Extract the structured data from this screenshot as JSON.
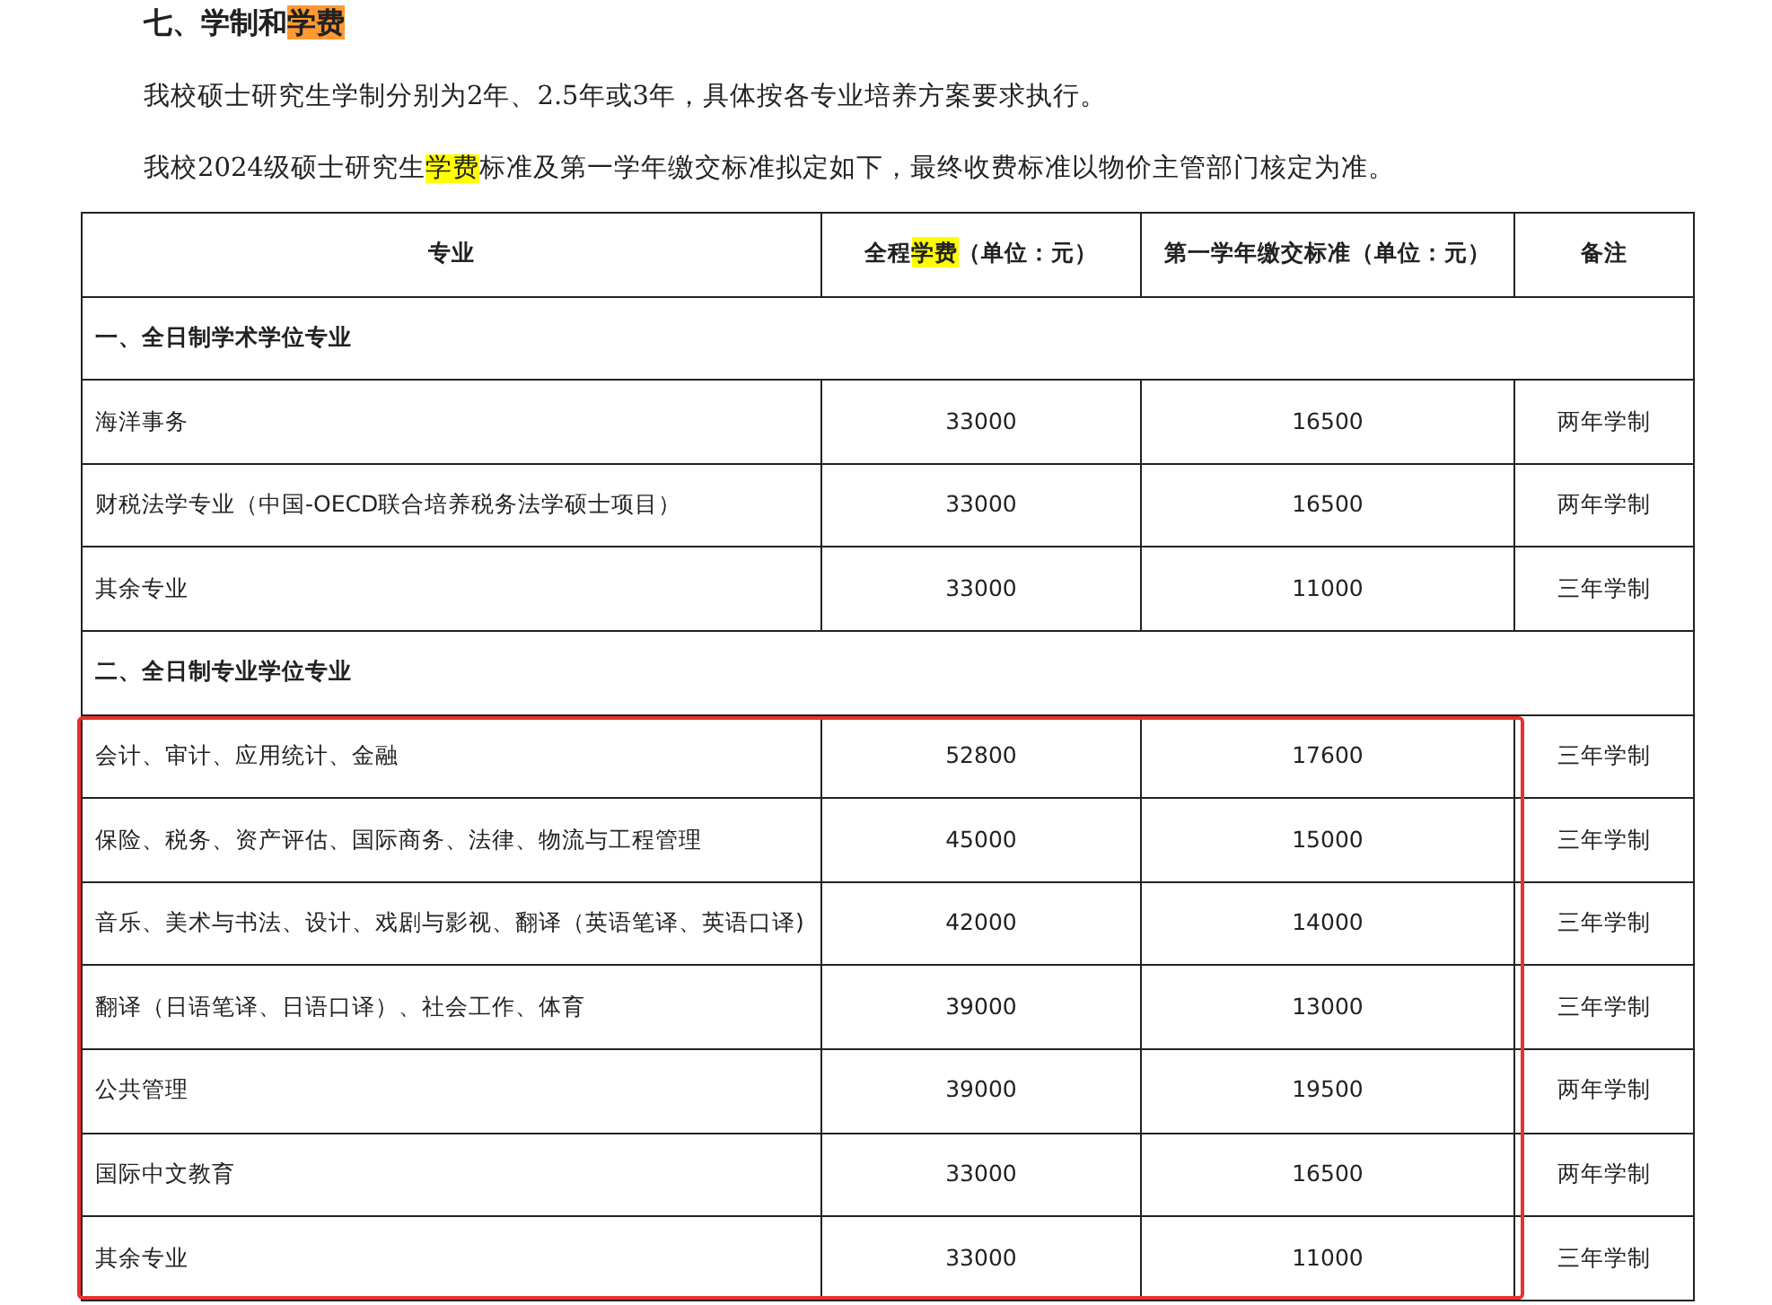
{
  "heading": {
    "segments": [
      {
        "text": "七、学制和"
      },
      {
        "text": "学费",
        "color": "#ff9933"
      }
    ]
  },
  "paragraphs": [
    {
      "segments": [
        {
          "text": "我校硕士研究生学制分别为2年、2.5年或3年，具体按各专业培养方案要求执行。"
        }
      ]
    },
    {
      "segments": [
        {
          "text": "我校2024级硕士研究生"
        },
        {
          "text": "学费",
          "color": "#ffff00"
        },
        {
          "text": "标准及第一学年缴交标准拟定如下，最终收费标准以物价主管部门核定为准。"
        }
      ]
    }
  ],
  "table": {
    "columns": [
      {
        "segments": [
          {
            "text": "专业"
          }
        ]
      },
      {
        "segments": [
          {
            "text": "全程"
          },
          {
            "text": "学费",
            "color": "#ffff00"
          },
          {
            "text": "（单位：元）"
          }
        ]
      },
      {
        "segments": [
          {
            "text": "第一学年缴交标准（单位：元）"
          }
        ]
      },
      {
        "segments": [
          {
            "text": "备注"
          }
        ]
      }
    ],
    "rows": [
      {
        "kind": "section",
        "label": "一、全日制学术学位专业"
      },
      {
        "kind": "data",
        "boxed": false,
        "cells": [
          "海洋事务",
          "33000",
          "16500",
          "两年学制"
        ]
      },
      {
        "kind": "data",
        "boxed": false,
        "cells": [
          "财税法学专业（中国-OECD联合培养税务法学硕士项目）",
          "33000",
          "16500",
          "两年学制"
        ]
      },
      {
        "kind": "data",
        "boxed": false,
        "cells": [
          "其余专业",
          "33000",
          "11000",
          "三年学制"
        ]
      },
      {
        "kind": "section",
        "label": "二、全日制专业学位专业"
      },
      {
        "kind": "data",
        "boxed": true,
        "cells": [
          "会计、审计、应用统计、金融",
          "52800",
          "17600",
          "三年学制"
        ]
      },
      {
        "kind": "data",
        "boxed": true,
        "cells": [
          "保险、税务、资产评估、国际商务、法律、物流与工程管理",
          "45000",
          "15000",
          "三年学制"
        ]
      },
      {
        "kind": "data",
        "boxed": true,
        "cells": [
          "音乐、美术与书法、设计、戏剧与影视、翻译（英语笔译、英语口译)",
          "42000",
          "14000",
          "三年学制"
        ]
      },
      {
        "kind": "data",
        "boxed": true,
        "cells": [
          "翻译（日语笔译、日语口译）、社会工作、体育",
          "39000",
          "13000",
          "三年学制"
        ]
      },
      {
        "kind": "data",
        "boxed": true,
        "cells": [
          "公共管理",
          "39000",
          "19500",
          "两年学制"
        ]
      },
      {
        "kind": "data",
        "boxed": true,
        "cells": [
          "国际中文教育",
          "33000",
          "16500",
          "两年学制"
        ]
      },
      {
        "kind": "data",
        "boxed": true,
        "cells": [
          "其余专业",
          "33000",
          "11000",
          "三年学制"
        ]
      }
    ]
  },
  "annotation": {
    "color": "#e8312f"
  }
}
